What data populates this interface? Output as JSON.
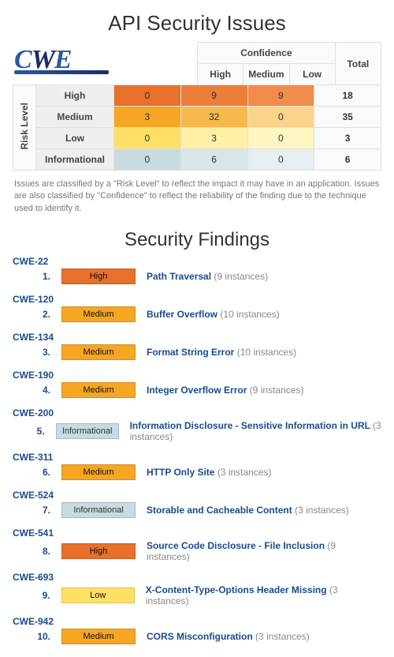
{
  "title": "API Security Issues",
  "logo": {
    "part1": "C",
    "part2": "W",
    "part3": "E"
  },
  "matrix": {
    "col_group_label": "Confidence",
    "columns": [
      "High",
      "Medium",
      "Low",
      "Total"
    ],
    "row_group_label": "Risk Level",
    "rows": [
      {
        "label": "High",
        "cells": [
          "0",
          "9",
          "9",
          "18"
        ],
        "colors": [
          "#e8702a",
          "#ed7d3a",
          "#f18c4d",
          "#fafafa"
        ]
      },
      {
        "label": "Medium",
        "cells": [
          "3",
          "32",
          "0",
          "35"
        ],
        "colors": [
          "#f6a623",
          "#f7b94d",
          "#fbd389",
          "#fafafa"
        ]
      },
      {
        "label": "Low",
        "cells": [
          "0",
          "3",
          "0",
          "3"
        ],
        "colors": [
          "#ffe066",
          "#fff0a6",
          "#fff6c2",
          "#fafafa"
        ]
      },
      {
        "label": "Informational",
        "cells": [
          "0",
          "6",
          "0",
          "6"
        ],
        "colors": [
          "#c7dbe1",
          "#d8e6ea",
          "#e6eff2",
          "#fafafa"
        ]
      }
    ]
  },
  "note": "Issues are classified by a \"Risk Level\" to reflect the impact it may have in an application. Issues are also classified by \"Confidence\" to reflect the reliability of the finding due to the technique used to identify it.",
  "findings_title": "Security Findings",
  "risk_labels": {
    "high": "High",
    "medium": "Medium",
    "low": "Low",
    "info": "Informational"
  },
  "findings": [
    {
      "idx": "1.",
      "cwe": "CWE-22",
      "risk": "high",
      "title": "Path Traversal",
      "count": "(9 instances)"
    },
    {
      "idx": "2.",
      "cwe": "CWE-120",
      "risk": "medium",
      "title": "Buffer Overflow",
      "count": "(10 instances)"
    },
    {
      "idx": "3.",
      "cwe": "CWE-134",
      "risk": "medium",
      "title": "Format String Error",
      "count": "(10 instances)"
    },
    {
      "idx": "4.",
      "cwe": "CWE-190",
      "risk": "medium",
      "title": "Integer Overflow Error",
      "count": "(9 instances)"
    },
    {
      "idx": "5.",
      "cwe": "CWE-200",
      "risk": "info",
      "title": "Information Disclosure - Sensitive Information in URL",
      "count": "(3 instances)"
    },
    {
      "idx": "6.",
      "cwe": "CWE-311",
      "risk": "medium",
      "title": "HTTP Only Site",
      "count": "(3 instances)"
    },
    {
      "idx": "7.",
      "cwe": "CWE-524",
      "risk": "info",
      "title": "Storable and Cacheable Content",
      "count": "(3 instances)"
    },
    {
      "idx": "8.",
      "cwe": "CWE-541",
      "risk": "high",
      "title": "Source Code Disclosure - File Inclusion",
      "count": "(9 instances)"
    },
    {
      "idx": "9.",
      "cwe": "CWE-693",
      "risk": "low",
      "title": "X-Content-Type-Options Header Missing",
      "count": "(3 instances)"
    },
    {
      "idx": "10.",
      "cwe": "CWE-942",
      "risk": "medium",
      "title": "CORS Misconfiguration",
      "count": "(3 instances)"
    }
  ]
}
